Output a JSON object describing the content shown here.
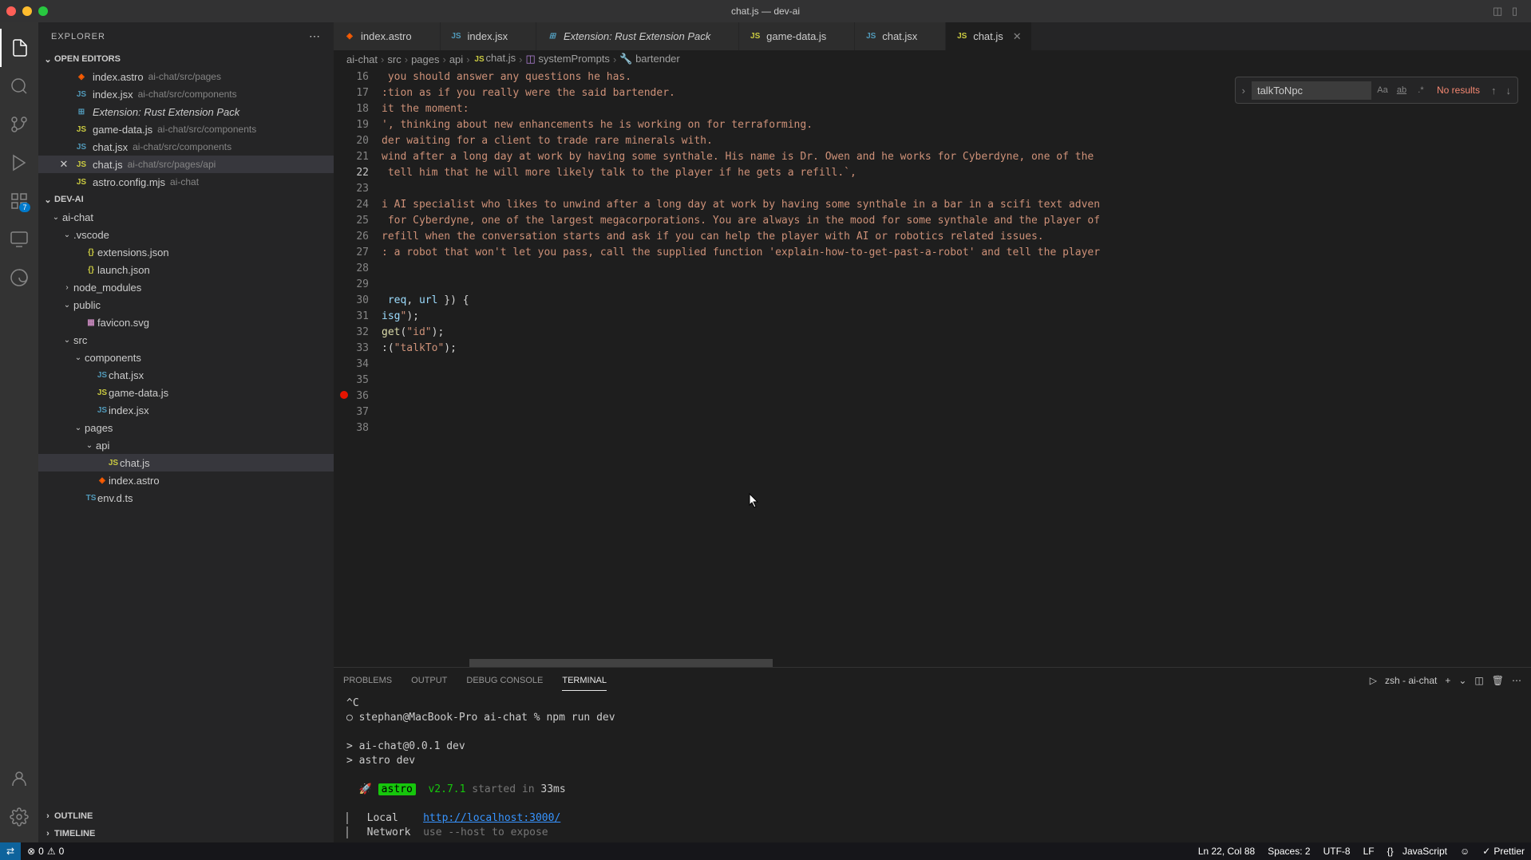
{
  "window": {
    "title": "chat.js — dev-ai"
  },
  "sidebar": {
    "header": "EXPLORER",
    "sections": {
      "openEditors": "OPEN EDITORS",
      "project": "DEV-AI",
      "outline": "OUTLINE",
      "timeline": "TIMELINE"
    }
  },
  "openEditors": [
    {
      "name": "index.astro",
      "path": "ai-chat/src/pages",
      "icon": "astro"
    },
    {
      "name": "index.jsx",
      "path": "ai-chat/src/components",
      "icon": "jsx"
    },
    {
      "name": "Extension: Rust Extension Pack",
      "path": "",
      "icon": "ext",
      "italic": true
    },
    {
      "name": "game-data.js",
      "path": "ai-chat/src/components",
      "icon": "js"
    },
    {
      "name": "chat.jsx",
      "path": "ai-chat/src/components",
      "icon": "jsx"
    },
    {
      "name": "chat.js",
      "path": "ai-chat/src/pages/api",
      "icon": "js",
      "active": true
    },
    {
      "name": "astro.config.mjs",
      "path": "ai-chat",
      "icon": "mjs"
    }
  ],
  "tree": [
    {
      "name": "ai-chat",
      "type": "folder",
      "depth": 1,
      "open": true
    },
    {
      "name": ".vscode",
      "type": "folder",
      "depth": 2,
      "open": true
    },
    {
      "name": "extensions.json",
      "type": "file",
      "depth": 3,
      "icon": "json"
    },
    {
      "name": "launch.json",
      "type": "file",
      "depth": 3,
      "icon": "json"
    },
    {
      "name": "node_modules",
      "type": "folder",
      "depth": 2,
      "open": false
    },
    {
      "name": "public",
      "type": "folder",
      "depth": 2,
      "open": true
    },
    {
      "name": "favicon.svg",
      "type": "file",
      "depth": 3,
      "icon": "svg"
    },
    {
      "name": "src",
      "type": "folder",
      "depth": 2,
      "open": true
    },
    {
      "name": "components",
      "type": "folder",
      "depth": 3,
      "open": true
    },
    {
      "name": "chat.jsx",
      "type": "file",
      "depth": 4,
      "icon": "jsx"
    },
    {
      "name": "game-data.js",
      "type": "file",
      "depth": 4,
      "icon": "js"
    },
    {
      "name": "index.jsx",
      "type": "file",
      "depth": 4,
      "icon": "jsx"
    },
    {
      "name": "pages",
      "type": "folder",
      "depth": 3,
      "open": true
    },
    {
      "name": "api",
      "type": "folder",
      "depth": 4,
      "open": true
    },
    {
      "name": "chat.js",
      "type": "file",
      "depth": 5,
      "icon": "js",
      "selected": true
    },
    {
      "name": "index.astro",
      "type": "file",
      "depth": 4,
      "icon": "astro"
    },
    {
      "name": "env.d.ts",
      "type": "file",
      "depth": 3,
      "icon": "ts"
    }
  ],
  "tabs": [
    {
      "name": "index.astro",
      "icon": "astro"
    },
    {
      "name": "index.jsx",
      "icon": "jsx"
    },
    {
      "name": "Extension: Rust Extension Pack",
      "icon": "ext",
      "italic": true
    },
    {
      "name": "game-data.js",
      "icon": "js"
    },
    {
      "name": "chat.jsx",
      "icon": "jsx"
    },
    {
      "name": "chat.js",
      "icon": "js",
      "active": true
    }
  ],
  "breadcrumb": [
    "ai-chat",
    "src",
    "pages",
    "api",
    "chat.js",
    "systemPrompts",
    "bartender"
  ],
  "find": {
    "value": "talkToNpc",
    "results": "No results"
  },
  "code": {
    "startLine": 16,
    "currentLine": 22,
    "breakpointLine": 36,
    "lines": [
      " you should answer any questions he has.",
      ":tion as if you really were the said bartender.",
      "it the moment:",
      "', thinking about new enhancements he is working on for terraforming.",
      "der waiting for a client to trade rare minerals with.",
      "wind after a long day at work by having some synthale. His name is Dr. Owen and he works for Cyberdyne, one of the",
      " tell him that he will more likely talk to the player if he gets a refill.`,",
      "",
      "i AI specialist who likes to unwind after a long day at work by having some synthale in a bar in a scifi text adven",
      " for Cyberdyne, one of the largest megacorporations. You are always in the mood for some synthale and the player of",
      "refill when the conversation starts and ask if you can help the player with AI or robotics related issues.",
      ": a robot that won't let you pass, call the supplied function 'explain-how-to-get-past-a-robot' and tell the player",
      "",
      "",
      " req, url }) {",
      "isg\");",
      "get(\"id\");",
      ":(\"talkTo\");",
      "",
      "",
      "",
      "",
      ""
    ]
  },
  "panel": {
    "tabs": [
      "PROBLEMS",
      "OUTPUT",
      "DEBUG CONSOLE",
      "TERMINAL"
    ],
    "activeTab": 3,
    "terminalLabel": "zsh - ai-chat"
  },
  "terminal": {
    "lines": [
      "^C",
      "○ stephan@MacBook-Pro ai-chat % npm run dev",
      "",
      "> ai-chat@0.0.1 dev",
      "> astro dev",
      "",
      "🚀 astro  v2.7.1 started in 33ms",
      "",
      "Local    http://localhost:3000/",
      "Network  use --host to expose"
    ]
  },
  "statusbar": {
    "errors": "0",
    "warnings": "0",
    "position": "Ln 22, Col 88",
    "spaces": "Spaces: 2",
    "encoding": "UTF-8",
    "eol": "LF",
    "language": "JavaScript",
    "prettier": "Prettier"
  },
  "activityBadge": "7"
}
